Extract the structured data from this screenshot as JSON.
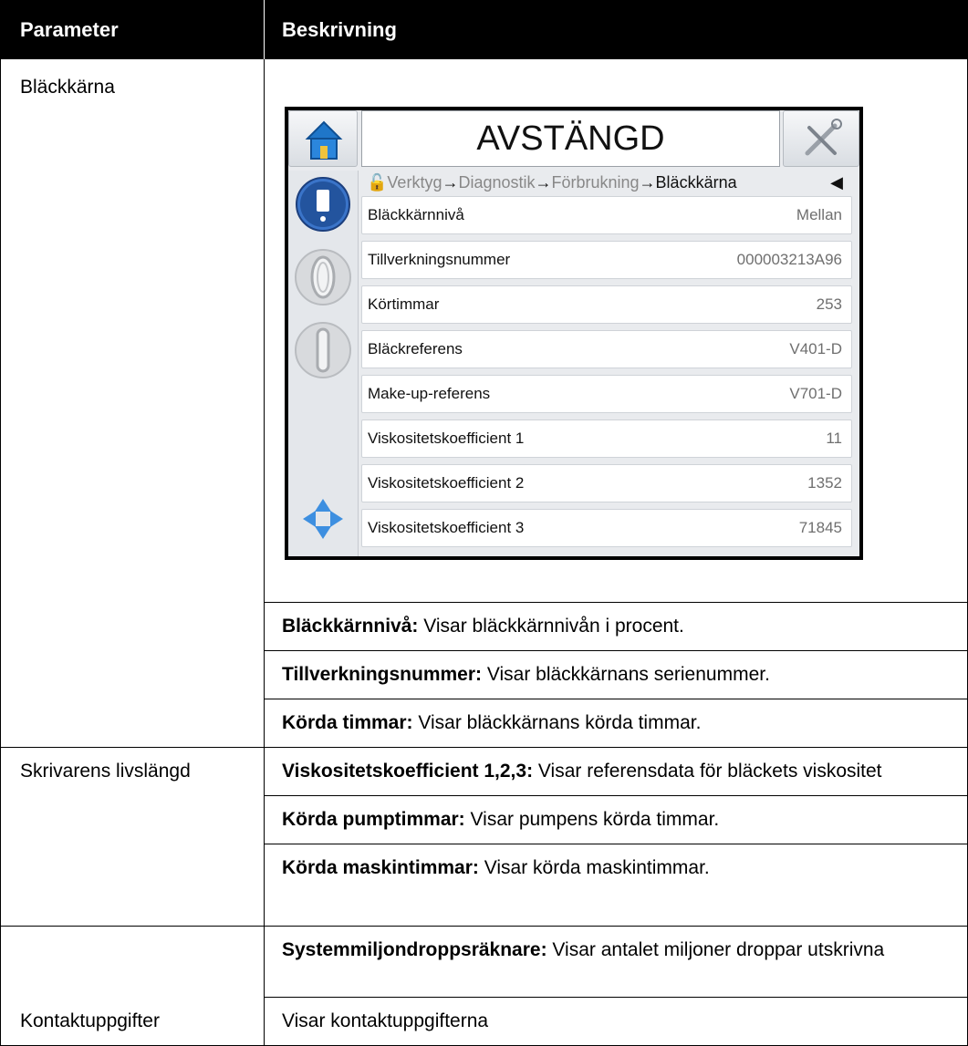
{
  "table": {
    "header": {
      "parameter": "Parameter",
      "description": "Beskrivning"
    },
    "rows": [
      {
        "parameter": "Bläckkärna",
        "descriptions": [
          {
            "term": "Bläckkärnnivå:",
            "text": " Visar bläckkärnnivån i procent."
          },
          {
            "term": "Tillverkningsnummer:",
            "text": " Visar bläckkärnans serienummer."
          },
          {
            "term": "Körda timmar:",
            "text": " Visar bläckkärnans körda timmar."
          },
          {
            "term": "Viskositetskoefficient 1,2,3:",
            "text": " Visar referensdata för bläckets viskositet"
          }
        ]
      },
      {
        "parameter": "Skrivarens livslängd",
        "descriptions": [
          {
            "term": "Körda pumptimmar:",
            "text": " Visar pumpens körda timmar."
          },
          {
            "term": "Körda maskintimmar:",
            "text": " Visar körda maskintimmar."
          },
          {
            "term": "Systemmiljondroppsräknare:",
            "text": " Visar antalet miljoner droppar utskrivna"
          }
        ]
      },
      {
        "parameter": "Kontaktuppgifter",
        "descriptions": [
          {
            "term": "",
            "text": "Visar kontaktuppgifterna"
          }
        ]
      }
    ]
  },
  "device": {
    "status": "AVSTÄNGD",
    "breadcrumb": {
      "items": [
        "Verktyg",
        "Diagnostik",
        "Förbrukning"
      ],
      "current": "Bläckkärna",
      "separator": "→"
    },
    "rows": [
      {
        "label": "Bläckkärnnivå",
        "value": "Mellan"
      },
      {
        "label": "Tillverkningsnummer",
        "value": "000003213A96"
      },
      {
        "label": "Körtimmar",
        "value": "253"
      },
      {
        "label": "Bläckreferens",
        "value": "V401-D"
      },
      {
        "label": "Make-up-referens",
        "value": "V701-D"
      },
      {
        "label": "Viskositetskoefficient 1",
        "value": "11"
      },
      {
        "label": "Viskositetskoefficient 2",
        "value": "1352"
      },
      {
        "label": "Viskositetskoefficient 3",
        "value": "71845"
      }
    ],
    "icons": {
      "home": "home-icon",
      "tools": "tools-icon",
      "ink_cartridge": "ink-cartridge-icon",
      "jet_start": "jet-start-icon",
      "jet_stop": "jet-stop-icon",
      "navigation": "navigation-arrows-icon",
      "lock": "lock-icon",
      "back": "back-arrow-icon"
    },
    "colors": {
      "accent_blue": "#2a6fc4",
      "nav_blue": "#3d8fe0"
    }
  }
}
